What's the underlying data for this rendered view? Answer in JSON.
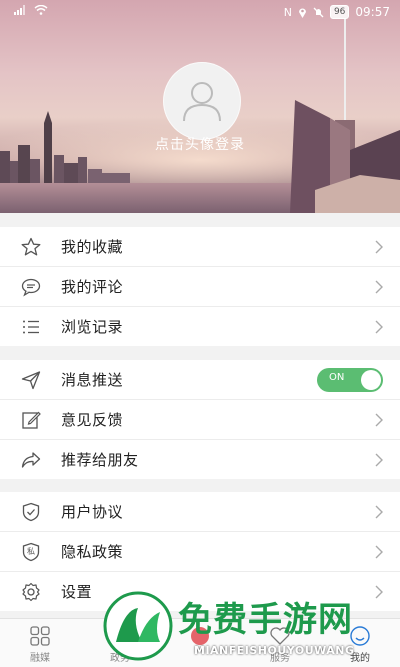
{
  "status_bar": {
    "time": "09:57",
    "battery": "96"
  },
  "profile": {
    "login_prompt": "点击头像登录"
  },
  "groups": [
    {
      "items": [
        {
          "label": "我的收藏",
          "icon": "star-icon"
        },
        {
          "label": "我的评论",
          "icon": "comment-icon"
        },
        {
          "label": "浏览记录",
          "icon": "list-icon"
        }
      ]
    },
    {
      "items": [
        {
          "label": "消息推送",
          "icon": "send-icon",
          "toggle": true,
          "toggle_text": "ON"
        },
        {
          "label": "意见反馈",
          "icon": "edit-icon"
        },
        {
          "label": "推荐给朋友",
          "icon": "share-icon"
        }
      ]
    },
    {
      "items": [
        {
          "label": "用户协议",
          "icon": "shield-icon"
        },
        {
          "label": "隐私政策",
          "icon": "privacy-icon",
          "icon_char": "私"
        },
        {
          "label": "设置",
          "icon": "gear-icon"
        }
      ]
    }
  ],
  "tabs": [
    {
      "label": "融媒",
      "icon": "grid-icon"
    },
    {
      "label": "政务",
      "icon": "gov-icon"
    },
    {
      "label": "",
      "icon": "center-icon"
    },
    {
      "label": "服务",
      "icon": "heart-icon"
    },
    {
      "label": "我的",
      "icon": "user-icon",
      "active": true
    }
  ],
  "watermark": {
    "text": "免费手游网",
    "sub": "MIANFEISHOUYOUWANG"
  },
  "colors": {
    "accent": "#5bbd72",
    "watermark": "#1e9a4c"
  }
}
